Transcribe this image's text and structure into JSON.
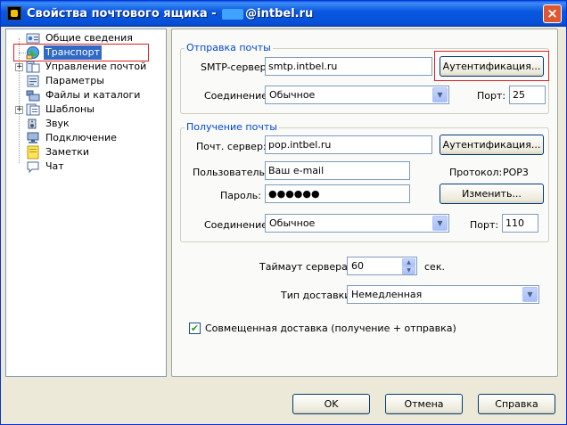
{
  "window": {
    "title_prefix": "Свойства почтового ящика -",
    "title_suffix": "@intbel.ru",
    "close_glyph": "×"
  },
  "tree": {
    "items": [
      {
        "label": "Общие сведения",
        "icon": "info-card-icon"
      },
      {
        "label": "Транспорт",
        "icon": "transport-globe-icon",
        "selected": true
      },
      {
        "label": "Управление почтой",
        "icon": "mail-management-icon",
        "expandable": true
      },
      {
        "label": "Параметры",
        "icon": "parameters-icon"
      },
      {
        "label": "Файлы и каталоги",
        "icon": "folder-icon"
      },
      {
        "label": "Шаблоны",
        "icon": "templates-icon",
        "expandable": true
      },
      {
        "label": "Звук",
        "icon": "speaker-icon"
      },
      {
        "label": "Подключение",
        "icon": "connection-icon"
      },
      {
        "label": "Заметки",
        "icon": "notes-icon"
      },
      {
        "label": "Чат",
        "icon": "chat-icon"
      }
    ],
    "expander_glyph": "+"
  },
  "send": {
    "legend": "Отправка почты",
    "smtp_label": "SMTP-сервер:",
    "smtp_value": "smtp.intbel.ru",
    "auth_button": "Аутентификация...",
    "conn_label": "Соединение:",
    "conn_value": "Обычное",
    "port_label": "Порт:",
    "port_value": "25"
  },
  "receive": {
    "legend": "Получение почты",
    "server_label": "Почт. сервер:",
    "server_value": "pop.intbel.ru",
    "auth_button": "Аутентификация...",
    "user_label": "Пользователь:",
    "user_value": "Ваш e-mail",
    "protocol_label": "Протокол:",
    "protocol_value": "POP3",
    "password_label": "Пароль:",
    "password_value": "●●●●●●",
    "change_button": "Изменить...",
    "conn_label": "Соединение:",
    "conn_value": "Обычное",
    "port_label": "Порт:",
    "port_value": "110"
  },
  "timeout": {
    "label": "Таймаут сервера:",
    "value": "60",
    "unit": "сек.",
    "up_glyph": "▲",
    "down_glyph": "▼"
  },
  "delivery": {
    "label": "Тип доставки",
    "value": "Немедленная"
  },
  "combined": {
    "label": "Совмещенная доставка (получение + отправка)",
    "checked": true,
    "check_glyph": "✔"
  },
  "combo_arrow": "▼",
  "buttons": {
    "ok": "OK",
    "cancel": "Отмена",
    "help": "Справка"
  },
  "colors": {
    "titlebar": "#0a58e0",
    "selection": "#316ac5",
    "group_legend": "#0046d5",
    "highlight_box": "#e02020"
  }
}
